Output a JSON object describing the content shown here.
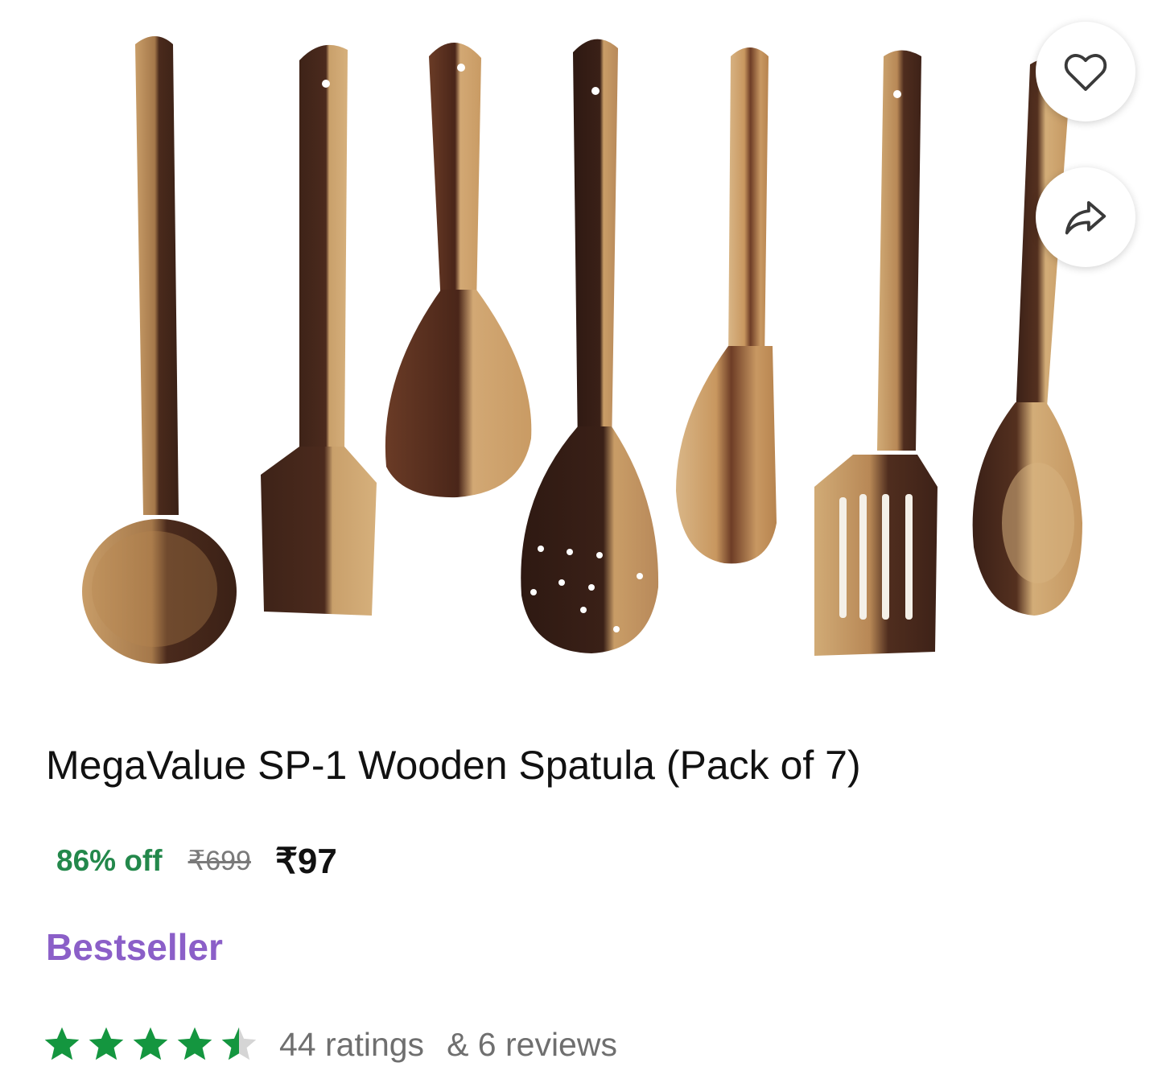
{
  "product": {
    "image_alt": "Wooden spatula set",
    "title": "MegaValue SP-1 Wooden Spatula (Pack of 7)",
    "discount": "86% off",
    "mrp": "₹699",
    "price": "₹97",
    "badge": "Bestseller",
    "rating": 4.5,
    "rating_max": 5,
    "ratings_count_label": "44 ratings",
    "reviews_count_label": "& 6 reviews"
  },
  "actions": {
    "wishlist_icon": "heart-icon",
    "share_icon": "share-arrow-icon"
  },
  "colors": {
    "discount": "#23884b",
    "badge": "#8b5fc8",
    "star_filled": "#14963f",
    "star_empty": "#d5d5d5",
    "wood_light": "#c9a06b",
    "wood_dark": "#4a2a1c"
  }
}
